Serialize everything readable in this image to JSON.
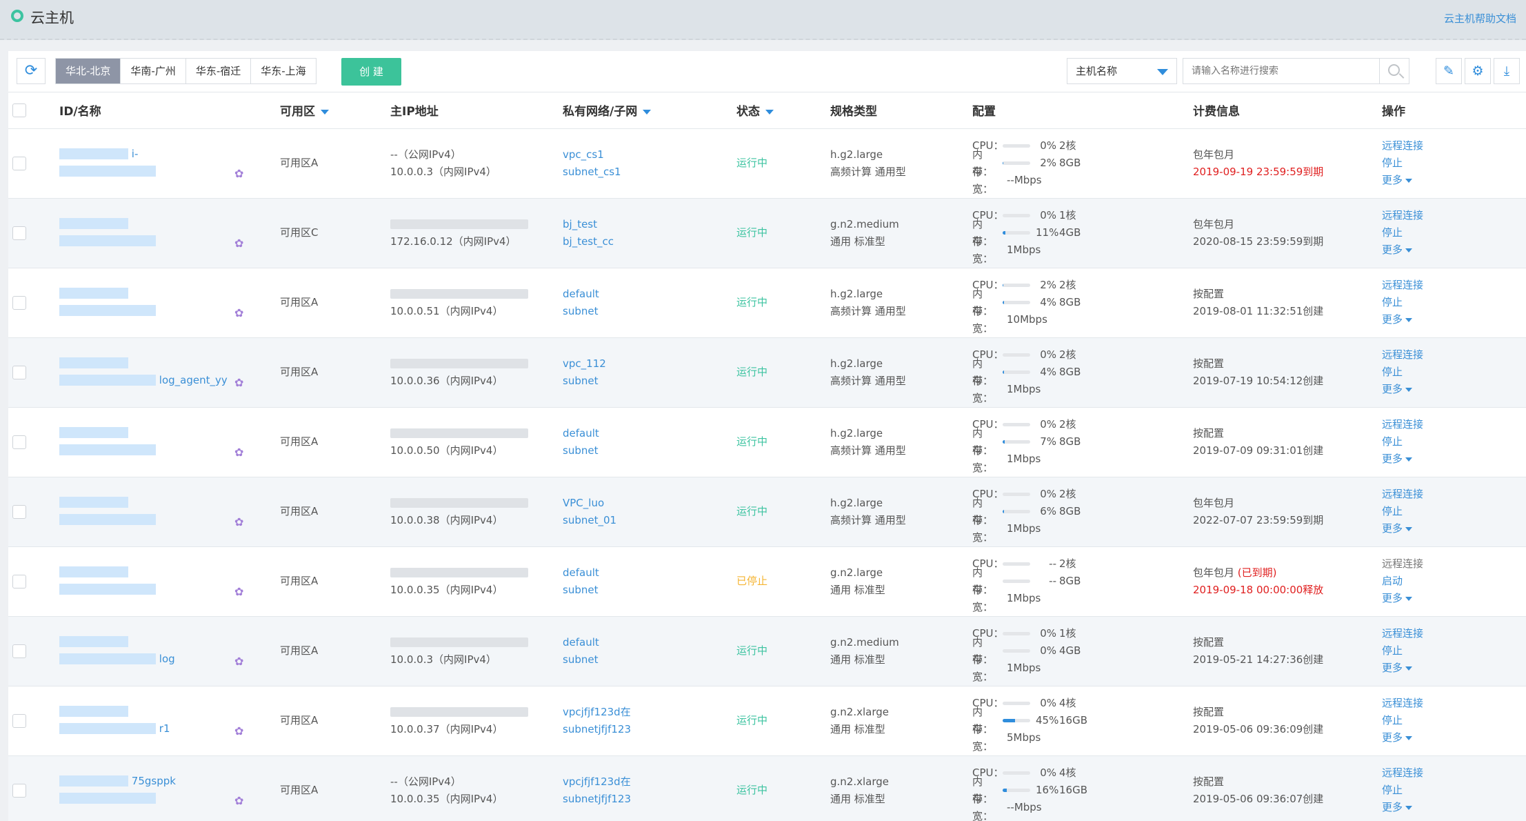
{
  "header": {
    "title": "云主机",
    "help_link": "云主机帮助文档"
  },
  "toolbar": {
    "refresh_icon": "refresh-icon",
    "regions": [
      {
        "label": "华北-北京",
        "active": true
      },
      {
        "label": "华南-广州",
        "active": false
      },
      {
        "label": "华东-宿迁",
        "active": false
      },
      {
        "label": "华东-上海",
        "active": false
      }
    ],
    "create_label": "创 建",
    "filter_field": "主机名称",
    "search_placeholder": "请输入名称进行搜索",
    "icons": [
      "search-icon",
      "edit-icon",
      "settings-icon",
      "download-icon"
    ]
  },
  "table": {
    "columns": {
      "id": "ID/名称",
      "zone": "可用区",
      "ip": "主IP地址",
      "network": "私有网络/子网",
      "status": "状态",
      "spec": "规格类型",
      "config": "配置",
      "billing": "计费信息",
      "actions": "操作"
    },
    "config_labels": {
      "cpu": "CPU：",
      "mem": "内存：",
      "bw": "带宽："
    },
    "rows": [
      {
        "id_visible": "i-",
        "name_visible": "",
        "zone": "可用区A",
        "ip_public": "--（公网IPv4）",
        "ip_private": "10.0.0.3（内网IPv4）",
        "vpc": "vpc_cs1",
        "subnet": "subnet_cs1",
        "status": "运行中",
        "status_type": "running",
        "spec": "h.g2.large",
        "spec_desc": "高频计算 通用型",
        "cpu_pct": "0%",
        "cpu_pct_num": 0,
        "cpu_cores": "2核",
        "mem_pct": "2%",
        "mem_pct_num": 2,
        "mem_size": "8GB",
        "bandwidth": "--Mbps",
        "billing_type": "包年包月",
        "billing_expired": "",
        "billing_date": "2019-09-19 23:59:59到期",
        "billing_date_red": true,
        "action1": "远程连接",
        "action1_enabled": true,
        "action2": "停止",
        "action3": "更多"
      },
      {
        "id_visible": "",
        "name_visible": "",
        "zone": "可用区C",
        "ip_public": "",
        "ip_private": "172.16.0.12（内网IPv4）",
        "vpc": "bj_test",
        "subnet": "bj_test_cc",
        "status": "运行中",
        "status_type": "running",
        "spec": "g.n2.medium",
        "spec_desc": "通用 标准型",
        "cpu_pct": "0%",
        "cpu_pct_num": 0,
        "cpu_cores": "1核",
        "mem_pct": "11%",
        "mem_pct_num": 11,
        "mem_size": "4GB",
        "bandwidth": "1Mbps",
        "billing_type": "包年包月",
        "billing_expired": "",
        "billing_date": "2020-08-15 23:59:59到期",
        "billing_date_red": false,
        "action1": "远程连接",
        "action1_enabled": true,
        "action2": "停止",
        "action3": "更多"
      },
      {
        "id_visible": "",
        "name_visible": "",
        "zone": "可用区A",
        "ip_public": "",
        "ip_private": "10.0.0.51（内网IPv4）",
        "vpc": "default",
        "subnet": "subnet",
        "status": "运行中",
        "status_type": "running",
        "spec": "h.g2.large",
        "spec_desc": "高频计算 通用型",
        "cpu_pct": "2%",
        "cpu_pct_num": 2,
        "cpu_cores": "2核",
        "mem_pct": "4%",
        "mem_pct_num": 4,
        "mem_size": "8GB",
        "bandwidth": "10Mbps",
        "billing_type": "按配置",
        "billing_expired": "",
        "billing_date": "2019-08-01 11:32:51创建",
        "billing_date_red": false,
        "action1": "远程连接",
        "action1_enabled": true,
        "action2": "停止",
        "action3": "更多"
      },
      {
        "id_visible": "",
        "name_visible": "log_agent_yy",
        "zone": "可用区A",
        "ip_public": "",
        "ip_private": "10.0.0.36（内网IPv4）",
        "vpc": "vpc_112",
        "subnet": "subnet",
        "status": "运行中",
        "status_type": "running",
        "spec": "h.g2.large",
        "spec_desc": "高频计算 通用型",
        "cpu_pct": "0%",
        "cpu_pct_num": 0,
        "cpu_cores": "2核",
        "mem_pct": "4%",
        "mem_pct_num": 4,
        "mem_size": "8GB",
        "bandwidth": "1Mbps",
        "billing_type": "按配置",
        "billing_expired": "",
        "billing_date": "2019-07-19 10:54:12创建",
        "billing_date_red": false,
        "action1": "远程连接",
        "action1_enabled": true,
        "action2": "停止",
        "action3": "更多"
      },
      {
        "id_visible": "",
        "name_visible": "",
        "zone": "可用区A",
        "ip_public": "",
        "ip_private": "10.0.0.50（内网IPv4）",
        "vpc": "default",
        "subnet": "subnet",
        "status": "运行中",
        "status_type": "running",
        "spec": "h.g2.large",
        "spec_desc": "高频计算 通用型",
        "cpu_pct": "0%",
        "cpu_pct_num": 0,
        "cpu_cores": "2核",
        "mem_pct": "7%",
        "mem_pct_num": 7,
        "mem_size": "8GB",
        "bandwidth": "1Mbps",
        "billing_type": "按配置",
        "billing_expired": "",
        "billing_date": "2019-07-09 09:31:01创建",
        "billing_date_red": false,
        "action1": "远程连接",
        "action1_enabled": true,
        "action2": "停止",
        "action3": "更多"
      },
      {
        "id_visible": "",
        "name_visible": "",
        "zone": "可用区A",
        "ip_public": "",
        "ip_private": "10.0.0.38（内网IPv4）",
        "vpc": "VPC_luo",
        "subnet": "subnet_01",
        "status": "运行中",
        "status_type": "running",
        "spec": "h.g2.large",
        "spec_desc": "高频计算 通用型",
        "cpu_pct": "0%",
        "cpu_pct_num": 0,
        "cpu_cores": "2核",
        "mem_pct": "6%",
        "mem_pct_num": 6,
        "mem_size": "8GB",
        "bandwidth": "1Mbps",
        "billing_type": "包年包月",
        "billing_expired": "",
        "billing_date": "2022-07-07 23:59:59到期",
        "billing_date_red": false,
        "action1": "远程连接",
        "action1_enabled": true,
        "action2": "停止",
        "action3": "更多"
      },
      {
        "id_visible": "",
        "name_visible": "",
        "zone": "可用区A",
        "ip_public": "",
        "ip_private": "10.0.0.35（内网IPv4）",
        "vpc": "default",
        "subnet": "subnet",
        "status": "已停止",
        "status_type": "stopped",
        "spec": "g.n2.large",
        "spec_desc": "通用 标准型",
        "cpu_pct": "--",
        "cpu_pct_num": 0,
        "cpu_cores": "2核",
        "mem_pct": "--",
        "mem_pct_num": 0,
        "mem_size": "8GB",
        "bandwidth": "1Mbps",
        "billing_type": "包年包月",
        "billing_expired": "(已到期)",
        "billing_date": "2019-09-18 00:00:00释放",
        "billing_date_red": true,
        "action1": "远程连接",
        "action1_enabled": false,
        "action2": "启动",
        "action3": "更多"
      },
      {
        "id_visible": "",
        "name_visible": "log",
        "zone": "可用区A",
        "ip_public": "",
        "ip_private": "10.0.0.3（内网IPv4）",
        "vpc": "default",
        "subnet": "subnet",
        "status": "运行中",
        "status_type": "running",
        "spec": "g.n2.medium",
        "spec_desc": "通用 标准型",
        "cpu_pct": "0%",
        "cpu_pct_num": 0,
        "cpu_cores": "1核",
        "mem_pct": "0%",
        "mem_pct_num": 0,
        "mem_size": "4GB",
        "bandwidth": "1Mbps",
        "billing_type": "按配置",
        "billing_expired": "",
        "billing_date": "2019-05-21 14:27:36创建",
        "billing_date_red": false,
        "action1": "远程连接",
        "action1_enabled": true,
        "action2": "停止",
        "action3": "更多"
      },
      {
        "id_visible": "",
        "name_visible": "r1",
        "zone": "可用区A",
        "ip_public": "",
        "ip_private": "10.0.0.37（内网IPv4）",
        "vpc": "vpcjfjf123d在",
        "subnet": "subnetjfjf123",
        "status": "运行中",
        "status_type": "running",
        "spec": "g.n2.xlarge",
        "spec_desc": "通用 标准型",
        "cpu_pct": "0%",
        "cpu_pct_num": 0,
        "cpu_cores": "4核",
        "mem_pct": "45%",
        "mem_pct_num": 45,
        "mem_size": "16GB",
        "bandwidth": "5Mbps",
        "billing_type": "按配置",
        "billing_expired": "",
        "billing_date": "2019-05-06 09:36:09创建",
        "billing_date_red": false,
        "action1": "远程连接",
        "action1_enabled": true,
        "action2": "停止",
        "action3": "更多"
      },
      {
        "id_visible": "75gsppk",
        "name_visible": "",
        "zone": "可用区A",
        "ip_public": "--（公网IPv4）",
        "ip_private": "10.0.0.35（内网IPv4）",
        "vpc": "vpcjfjf123d在",
        "subnet": "subnetjfjf123",
        "status": "运行中",
        "status_type": "running",
        "spec": "g.n2.xlarge",
        "spec_desc": "通用 标准型",
        "cpu_pct": "0%",
        "cpu_pct_num": 0,
        "cpu_cores": "4核",
        "mem_pct": "16%",
        "mem_pct_num": 16,
        "mem_size": "16GB",
        "bandwidth": "--Mbps",
        "billing_type": "按配置",
        "billing_expired": "",
        "billing_date": "2019-05-06 09:36:07创建",
        "billing_date_red": false,
        "action1": "远程连接",
        "action1_enabled": true,
        "action2": "停止",
        "action3": "更多"
      }
    ]
  }
}
